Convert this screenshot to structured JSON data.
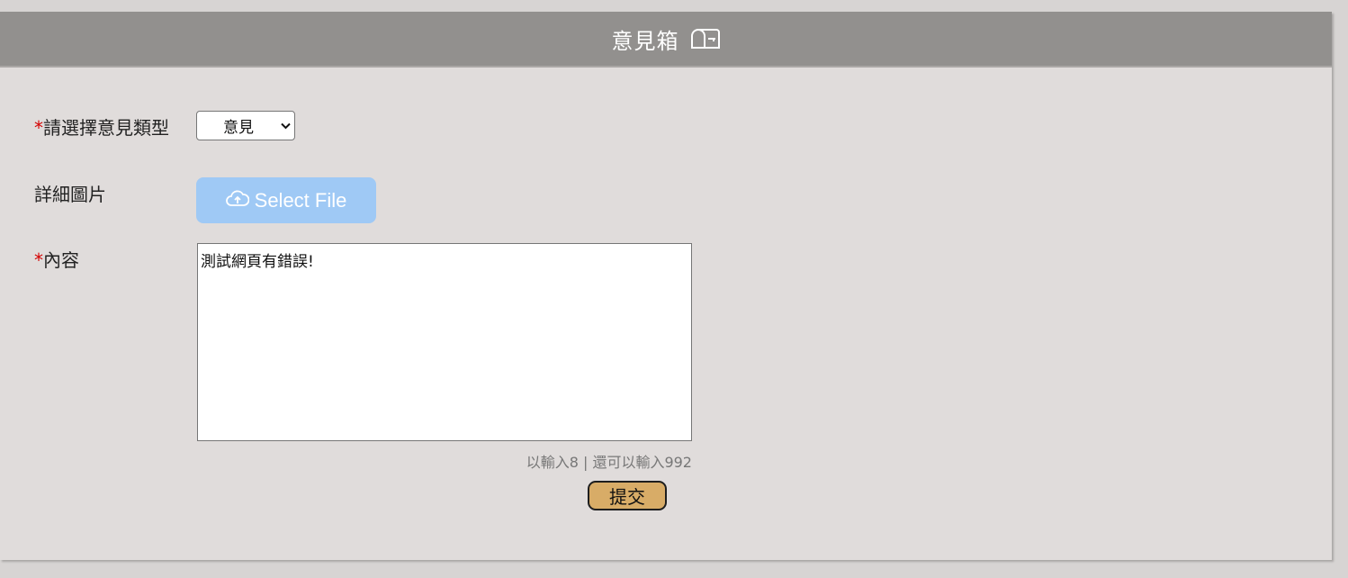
{
  "header": {
    "title": "意見箱",
    "icon": "mailbox-icon"
  },
  "form": {
    "type_field": {
      "required_mark": "*",
      "label": "請選擇意見類型",
      "selected_value": "意見"
    },
    "image_field": {
      "label": "詳細圖片",
      "button_label": "Select File",
      "button_icon": "cloud-upload-icon"
    },
    "content_field": {
      "required_mark": "*",
      "label": "內容",
      "value": "測試網頁有錯誤!",
      "counter": "以輸入8 | 還可以輸入992"
    },
    "submit_label": "提交"
  },
  "colors": {
    "header_bg": "#92908e",
    "panel_bg": "#e0dcdb",
    "upload_button_bg": "#9fc9f5",
    "submit_bg": "#d8ac67",
    "required_mark": "#d40000"
  }
}
